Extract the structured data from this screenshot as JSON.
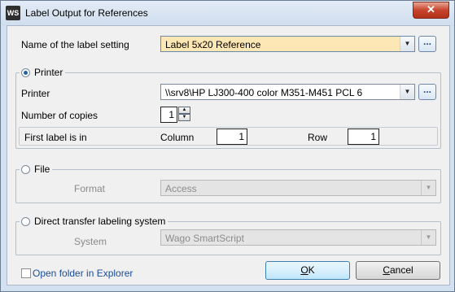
{
  "window": {
    "app_icon_text": "WS",
    "title": "Label Output for References",
    "close_glyph": "✕"
  },
  "label_setting": {
    "label": "Name of the label setting",
    "value": "Label 5x20 Reference",
    "browse_label": "..."
  },
  "printer_group": {
    "title": "Printer",
    "selected": true,
    "printer_label": "Printer",
    "printer_value": "\\\\srv8\\HP LJ300-400 color M351-M451 PCL 6",
    "browse_label": "...",
    "copies_label": "Number of copies",
    "copies_value": "1",
    "first_label": "First label is in",
    "column_label": "Column",
    "column_value": "1",
    "row_label": "Row",
    "row_value": "1"
  },
  "file_group": {
    "title": "File",
    "selected": false,
    "format_label": "Format",
    "format_value": "Access"
  },
  "direct_group": {
    "title": "Direct transfer labeling system",
    "selected": false,
    "system_label": "System",
    "system_value": "Wago SmartScript"
  },
  "footer": {
    "open_folder_label": "Open folder in Explorer",
    "ok_mnemonic": "O",
    "ok_rest": "K",
    "cancel_mnemonic": "C",
    "cancel_rest": "ancel"
  },
  "icons": {
    "dropdown": "▼",
    "spin_up": "▲",
    "spin_down": "▼"
  }
}
